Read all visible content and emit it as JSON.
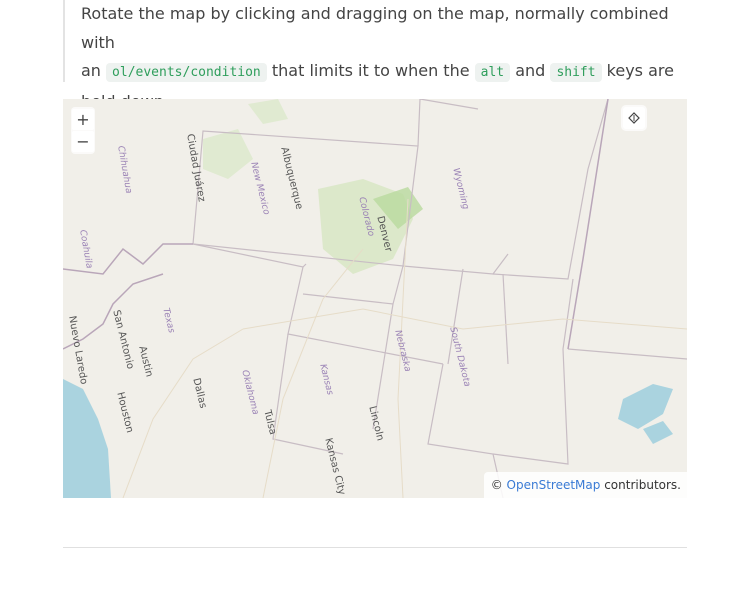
{
  "description": {
    "line1": "Rotate the map by clicking and dragging on the map, normally combined with",
    "an": "an",
    "code_condition": "ol/events/condition",
    "mid": "that limits it to when the",
    "code_alt": "alt",
    "and": "and",
    "code_shift": "shift",
    "end": "keys are held down."
  },
  "map": {
    "zoom_in": "+",
    "zoom_out": "−",
    "attribution_symbol": "©",
    "attribution_link": "OpenStreetMap",
    "attribution_suffix": "contributors.",
    "labels": {
      "chihuahua": "Chihuahua",
      "ciudad_juarez": "Ciudad Juárez",
      "new_mexico": "New Mexico",
      "albuquerque": "Albuquerque",
      "colorado": "Colorado",
      "denver": "Denver",
      "wyoming": "Wyoming",
      "coahuila": "Coahuila",
      "texas": "Texas",
      "nuevo_laredo": "Nuevo Laredo",
      "san_antonio": "San Antonio",
      "austin": "Austin",
      "houston": "Houston",
      "dallas": "Dallas",
      "oklahoma": "Oklahoma",
      "tulsa": "Tulsa",
      "kansas": "Kansas",
      "kansas_city": "Kansas City",
      "lincoln": "Lincoln",
      "nebraska": "Nebraska",
      "south_dakota": "South Dakota"
    }
  },
  "colors": {
    "code_text": "#2f9e5c",
    "link": "#3a7bd5",
    "water": "#aad3df",
    "land": "#f0eee8"
  }
}
